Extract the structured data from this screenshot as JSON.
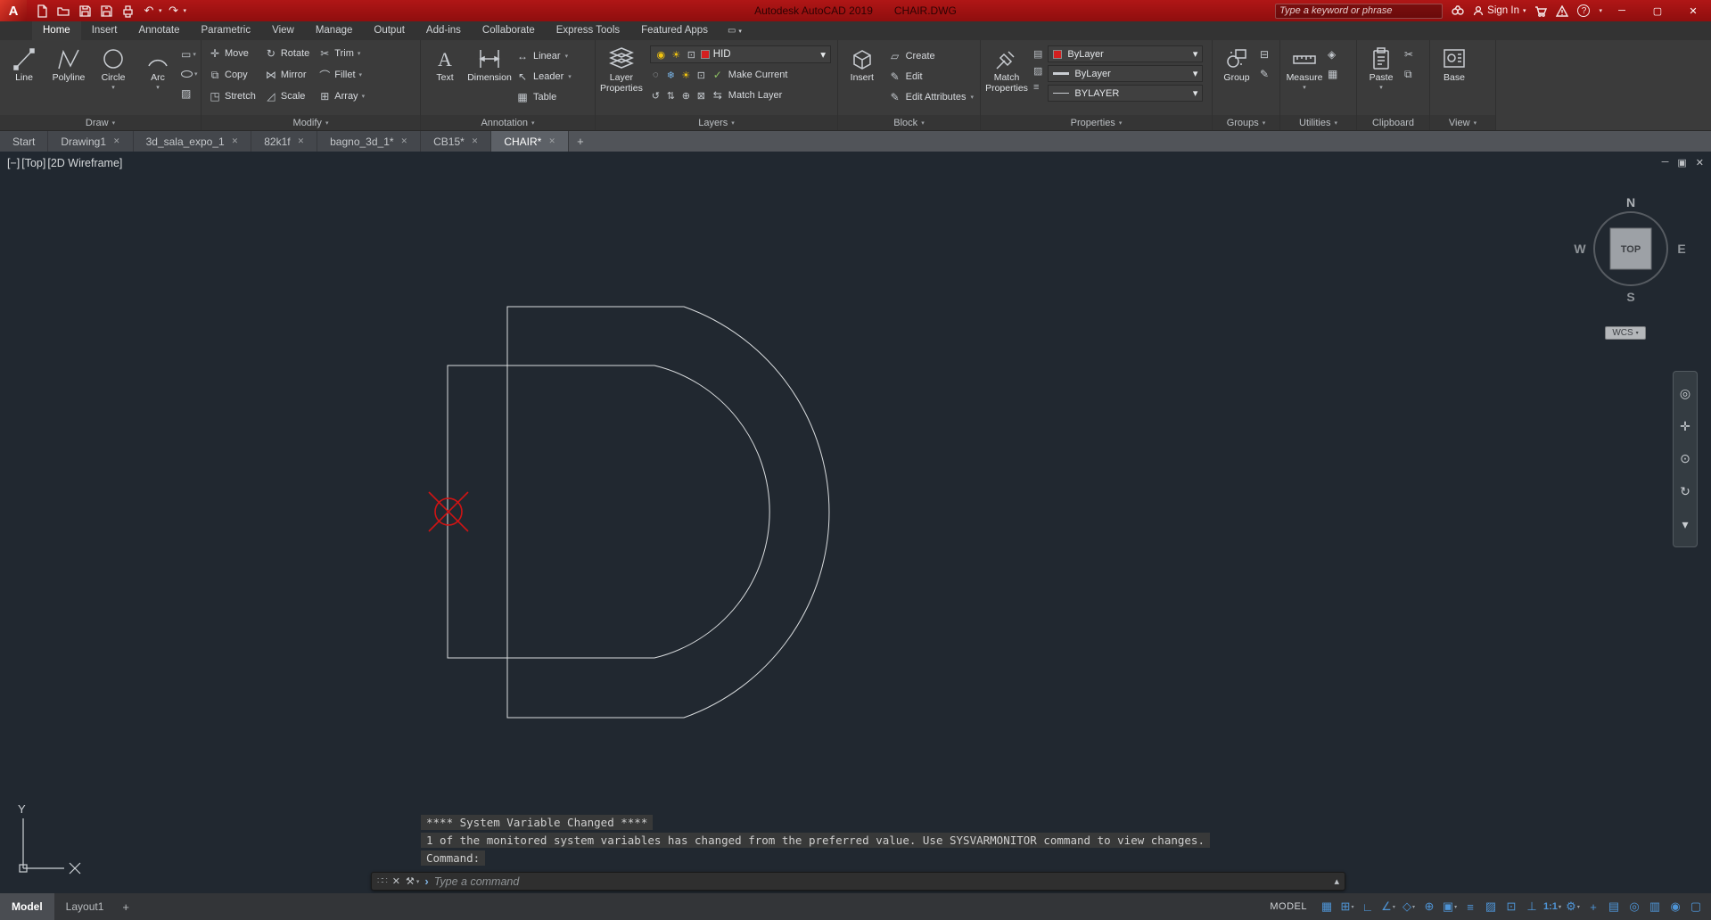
{
  "title_bar": {
    "logo": "A",
    "app_title": "Autodesk AutoCAD 2019",
    "doc_title": "CHAIR.DWG",
    "search_placeholder": "Type a keyword or phrase",
    "sign_in_label": "Sign In"
  },
  "ribbon_tabs": {
    "items": [
      "Home",
      "Insert",
      "Annotate",
      "Parametric",
      "View",
      "Manage",
      "Output",
      "Add-ins",
      "Collaborate",
      "Express Tools",
      "Featured Apps"
    ],
    "active": "Home"
  },
  "ribbon": {
    "draw": {
      "label": "Draw",
      "line": "Line",
      "polyline": "Polyline",
      "circle": "Circle",
      "arc": "Arc"
    },
    "modify": {
      "label": "Modify",
      "move": "Move",
      "rotate": "Rotate",
      "trim": "Trim",
      "copy": "Copy",
      "mirror": "Mirror",
      "fillet": "Fillet",
      "stretch": "Stretch",
      "scale": "Scale",
      "array": "Array"
    },
    "annotation": {
      "label": "Annotation",
      "text": "Text",
      "dimension": "Dimension",
      "linear": "Linear",
      "leader": "Leader",
      "table": "Table"
    },
    "layers": {
      "label": "Layers",
      "layer_properties": "Layer Properties",
      "current_layer": "HID",
      "make_current": "Make Current",
      "match_layer": "Match Layer"
    },
    "block": {
      "label": "Block",
      "insert": "Insert",
      "create": "Create",
      "edit": "Edit",
      "edit_attributes": "Edit Attributes"
    },
    "properties": {
      "label": "Properties",
      "match_properties": "Match Properties",
      "object_color": "ByLayer",
      "lineweight": "ByLayer",
      "linetype": "BYLAYER"
    },
    "groups": {
      "label": "Groups",
      "group": "Group"
    },
    "utilities": {
      "label": "Utilities",
      "measure": "Measure"
    },
    "clipboard": {
      "label": "Clipboard",
      "paste": "Paste"
    },
    "view": {
      "label": "View",
      "base": "Base"
    }
  },
  "file_tabs": {
    "items": [
      "Start",
      "Drawing1",
      "3d_sala_expo_1",
      "82k1f",
      "bagno_3d_1*",
      "CB15*",
      "CHAIR*"
    ],
    "active": "CHAIR*"
  },
  "viewport": {
    "controls": {
      "minimize": "[−]",
      "view_name": "[Top]",
      "visual_style": "[2D Wireframe]"
    },
    "viewcube": {
      "n": "N",
      "e": "E",
      "s": "S",
      "w": "W",
      "face": "TOP"
    },
    "wcs_label": "WCS",
    "ucs": {
      "y_label": "Y",
      "x_label": "✕"
    }
  },
  "command_line": {
    "messages": [
      "**** System Variable Changed ****",
      "1 of the monitored system variables has changed from the preferred value. Use SYSVARMONITOR command to view changes.",
      "Command:"
    ],
    "input_placeholder": "Type a command"
  },
  "status_bar": {
    "model_tab": "Model",
    "layout_tab": "Layout1",
    "new_layout": "+",
    "model_space_label": "MODEL",
    "annotation_scale": "1:1"
  },
  "colors": {
    "titlebar_red": "#a31414",
    "viewport_bg": "#212830",
    "accent_blue": "#4e94d6",
    "drawing_line": "#d9dcde",
    "marker_red": "#cf1414",
    "layer_color_swatch": "#d42020"
  },
  "icons": {
    "caret_down": "▾",
    "caret_up": "▴",
    "close": "✕",
    "minimize": "─",
    "maximize": "▢",
    "restore": "▣",
    "undo": "↶",
    "redo": "↷",
    "grip": "∷∷",
    "wrench": "⚒",
    "prompt": "›",
    "grid": "▦",
    "snap": "⊞",
    "ortho": "∟",
    "polar": "∠",
    "isodraft": "◇",
    "otrack": "⊕",
    "osnap": "▣",
    "lineweight": "≡",
    "transparency": "▨",
    "cycling": "⊡",
    "ducs": "⊥",
    "annot_monitor": "▭",
    "gear": "⚙",
    "plus": "+",
    "quick_props": "▤",
    "isolate": "◎",
    "perf": "▥",
    "bell": "◉",
    "clean": "▢",
    "move": "✛",
    "rotate": "↻",
    "trim": "✂",
    "copy": "⧉",
    "mirror": "⋈",
    "fillet": "⌒",
    "stretch": "◳",
    "scale": "◿",
    "array": "⊞",
    "rect": "▭",
    "hatch": "▨",
    "linear": "↔",
    "leader": "↖",
    "table": "▦",
    "create": "▱",
    "edit": "✎",
    "bulb": "◉",
    "sun": "☀",
    "freeze": "❄",
    "off": "◌",
    "lock": "⊡",
    "unlock": "↺",
    "merge": "⇅",
    "walk": "⊕",
    "del": "⊠",
    "check": "✓",
    "matchlayer": "⇆",
    "props_list": "▤",
    "props_hatch": "▨",
    "props_lines": "≡",
    "ungroup": "⊟",
    "gedit": "✎",
    "idpoint": "◈",
    "qcalc": "▦",
    "cut": "✂",
    "copyclip": "⧉",
    "help": "?",
    "nav_wheel": "◎",
    "nav_pan": "✛",
    "nav_zoom": "⊙",
    "nav_orbit": "↻",
    "nav_more": "▾",
    "ribbon_state": "▭"
  }
}
